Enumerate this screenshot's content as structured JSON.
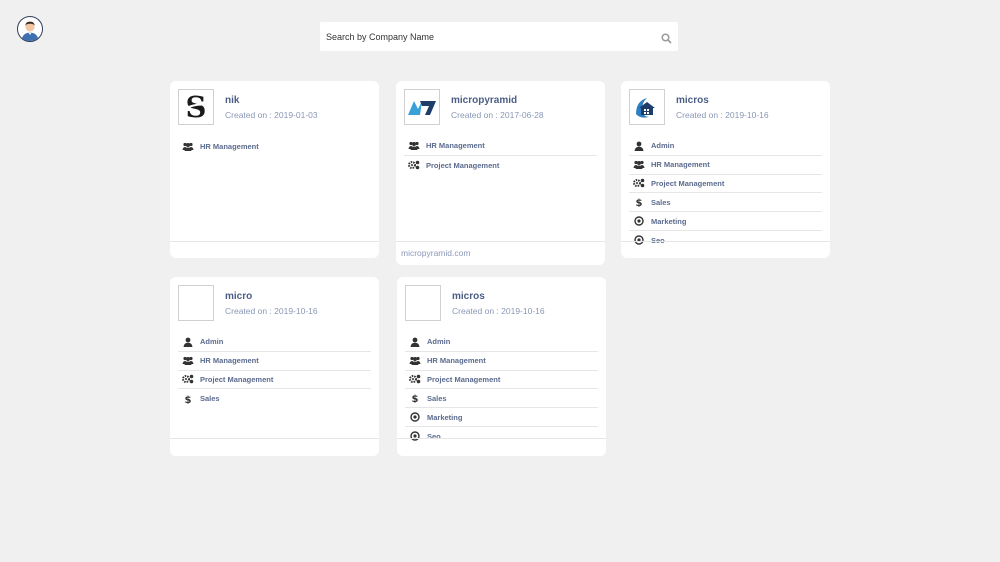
{
  "search": {
    "placeholder": "Search by Company Name"
  },
  "icons": {
    "avatar": "user-avatar",
    "search": "search-icon",
    "Admin": "user-icon",
    "HR Management": "users-icon",
    "Project Management": "cogs-icon",
    "Sales": "dollar-icon",
    "Marketing": "bullseye-icon",
    "Seo": "target-icon"
  },
  "colors": {
    "accent": "#4b5d85",
    "muted": "#8a97b5",
    "background": "#f0f0f0"
  },
  "companies": [
    {
      "name": "nik",
      "created": "Created on : 2019-01-03",
      "logo": "s-logo",
      "modules": [
        "HR Management"
      ],
      "website": ""
    },
    {
      "name": "micropyramid",
      "created": "Created on : 2017-06-28",
      "logo": "mp-logo",
      "modules": [
        "HR Management",
        "Project Management"
      ],
      "website": "micropyramid.com"
    },
    {
      "name": "micros",
      "created": "Created on : 2019-10-16",
      "logo": "house-logo",
      "modules": [
        "Admin",
        "HR Management",
        "Project Management",
        "Sales",
        "Marketing",
        "Seo"
      ],
      "website": ""
    },
    {
      "name": "micro",
      "created": "Created on : 2019-10-16",
      "logo": "blank",
      "modules": [
        "Admin",
        "HR Management",
        "Project Management",
        "Sales"
      ],
      "website": ""
    },
    {
      "name": "micros",
      "created": "Created on : 2019-10-16",
      "logo": "blank",
      "modules": [
        "Admin",
        "HR Management",
        "Project Management",
        "Sales",
        "Marketing",
        "Seo"
      ],
      "website": ""
    }
  ]
}
